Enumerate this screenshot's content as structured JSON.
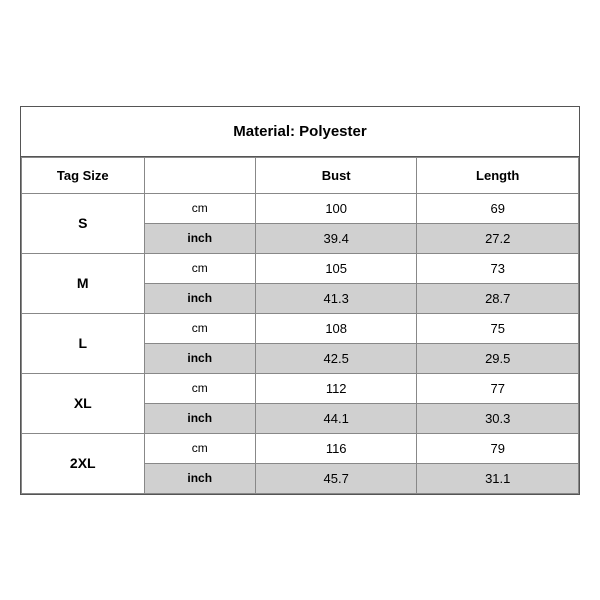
{
  "title": "Material: Polyester",
  "headers": {
    "tag_size": "Tag Size",
    "bust": "Bust",
    "length": "Length"
  },
  "rows": [
    {
      "size": "S",
      "cm": {
        "bust": "100",
        "length": "69"
      },
      "inch": {
        "bust": "39.4",
        "length": "27.2"
      }
    },
    {
      "size": "M",
      "cm": {
        "bust": "105",
        "length": "73"
      },
      "inch": {
        "bust": "41.3",
        "length": "28.7"
      }
    },
    {
      "size": "L",
      "cm": {
        "bust": "108",
        "length": "75"
      },
      "inch": {
        "bust": "42.5",
        "length": "29.5"
      }
    },
    {
      "size": "XL",
      "cm": {
        "bust": "112",
        "length": "77"
      },
      "inch": {
        "bust": "44.1",
        "length": "30.3"
      }
    },
    {
      "size": "2XL",
      "cm": {
        "bust": "116",
        "length": "79"
      },
      "inch": {
        "bust": "45.7",
        "length": "31.1"
      }
    }
  ],
  "units": {
    "cm": "cm",
    "inch": "inch"
  }
}
